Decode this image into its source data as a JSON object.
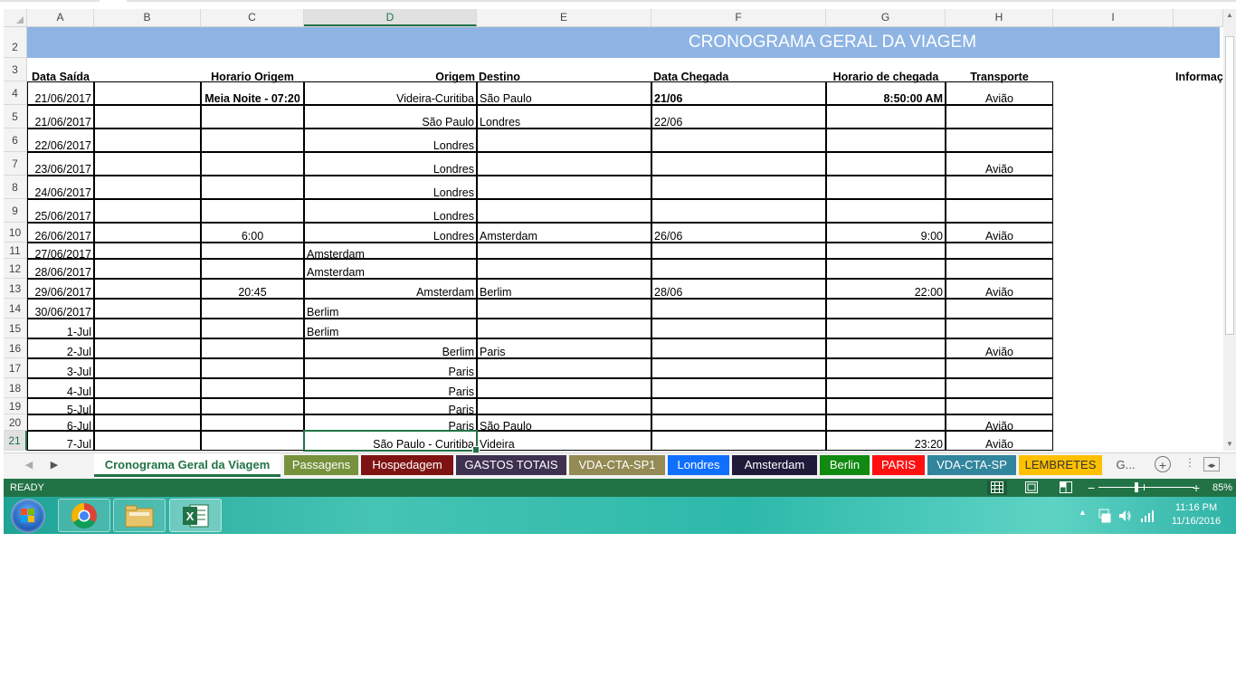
{
  "columns": [
    {
      "letter": "A",
      "width": 74
    },
    {
      "letter": "B",
      "width": 118
    },
    {
      "letter": "C",
      "width": 114
    },
    {
      "letter": "D",
      "width": 191
    },
    {
      "letter": "E",
      "width": 193
    },
    {
      "letter": "F",
      "width": 193
    },
    {
      "letter": "G",
      "width": 132
    },
    {
      "letter": "H",
      "width": 119
    },
    {
      "letter": "I",
      "width": 133
    }
  ],
  "selected_column": "D",
  "selected_row": "21",
  "title": "CRONOGRAMA GERAL DA VIAGEM",
  "headers": {
    "A": "Data Saída",
    "C": "Horario Origem",
    "D": "Origem",
    "E": "Destino",
    "F": "Data Chegada",
    "G": "Horario de chegada",
    "H": "Transporte",
    "J": "Informaç"
  },
  "rows": [
    {
      "num": "4",
      "A": "21/06/2017",
      "C": "Meia Noite - 07:20",
      "D": "Videira-Curitiba",
      "Dalign": "r",
      "E": "São Paulo",
      "F": "21/06",
      "G": "8:50:00 AM",
      "H": "Avião"
    },
    {
      "num": "5",
      "A": "21/06/2017",
      "C": "",
      "D": "São Paulo",
      "Dalign": "r",
      "E": "Londres",
      "F": "22/06",
      "G": "",
      "H": ""
    },
    {
      "num": "6",
      "A": "22/06/2017",
      "C": "",
      "D": "Londres",
      "Dalign": "r",
      "E": "",
      "F": "",
      "G": "",
      "H": ""
    },
    {
      "num": "7",
      "A": "23/06/2017",
      "C": "",
      "D": "Londres",
      "Dalign": "r",
      "E": "",
      "F": "",
      "G": "",
      "H": "Avião"
    },
    {
      "num": "8",
      "A": "24/06/2017",
      "C": "",
      "D": "Londres",
      "Dalign": "r",
      "E": "",
      "F": "",
      "G": "",
      "H": ""
    },
    {
      "num": "9",
      "A": "25/06/2017",
      "C": "",
      "D": "Londres",
      "Dalign": "r",
      "E": "",
      "F": "",
      "G": "",
      "H": ""
    },
    {
      "num": "10",
      "A": "26/06/2017",
      "C": "6:00",
      "D": "Londres",
      "Dalign": "r",
      "E": "Amsterdam",
      "F": "26/06",
      "G": "9:00",
      "H": "Avião"
    },
    {
      "num": "11",
      "A": "27/06/2017",
      "C": "",
      "D": "Amsterdam",
      "Dalign": "l",
      "E": "",
      "F": "",
      "G": "",
      "H": ""
    },
    {
      "num": "12",
      "A": "28/06/2017",
      "C": "",
      "D": "Amsterdam",
      "Dalign": "l",
      "E": "",
      "F": "",
      "G": "",
      "H": ""
    },
    {
      "num": "13",
      "A": "29/06/2017",
      "C": "20:45",
      "D": "Amsterdam",
      "Dalign": "r",
      "E": "Berlim",
      "F": "28/06",
      "G": "22:00",
      "H": "Avião"
    },
    {
      "num": "14",
      "A": "30/06/2017",
      "C": "",
      "D": "Berlim",
      "Dalign": "l",
      "E": "",
      "F": "",
      "G": "",
      "H": ""
    },
    {
      "num": "15",
      "A": "1-Jul",
      "C": "",
      "D": "Berlim",
      "Dalign": "l",
      "E": "",
      "F": "",
      "G": "",
      "H": ""
    },
    {
      "num": "16",
      "A": "2-Jul",
      "C": "",
      "D": "Berlim",
      "Dalign": "r",
      "E": "Paris",
      "F": "",
      "G": "",
      "H": "Avião"
    },
    {
      "num": "17",
      "A": "3-Jul",
      "C": "",
      "D": "Paris",
      "Dalign": "r",
      "E": "",
      "F": "",
      "G": "",
      "H": ""
    },
    {
      "num": "18",
      "A": "4-Jul",
      "C": "",
      "D": "Paris",
      "Dalign": "r",
      "E": "",
      "F": "",
      "G": "",
      "H": ""
    },
    {
      "num": "19",
      "A": "5-Jul",
      "C": "",
      "D": "Paris",
      "Dalign": "r",
      "E": "",
      "F": "",
      "G": "",
      "H": ""
    },
    {
      "num": "20",
      "A": "6-Jul",
      "C": "",
      "D": "Paris",
      "Dalign": "r",
      "E": "São Paulo",
      "F": "",
      "G": "",
      "H": "Avião"
    },
    {
      "num": "21",
      "A": "7-Jul",
      "C": "",
      "D": "São Paulo - Curitiba",
      "Dalign": "r",
      "E": "Videira",
      "F": "",
      "G": "23:20",
      "H": "Avião"
    }
  ],
  "tabs": [
    {
      "label": "Cronograma Geral da Viagem",
      "color": "#ffffff",
      "active": true
    },
    {
      "label": "Passagens",
      "color": "#76923c"
    },
    {
      "label": "Hospedagem",
      "color": "#7f1313"
    },
    {
      "label": "GASTOS TOTAIS",
      "color": "#3f3151"
    },
    {
      "label": "VDA-CTA-SP1",
      "color": "#948a54"
    },
    {
      "label": "Londres",
      "color": "#0f6fff"
    },
    {
      "label": "Amsterdam",
      "color": "#1f1a3a"
    },
    {
      "label": "Berlin",
      "color": "#108a10"
    },
    {
      "label": "PARIS",
      "color": "#ff1010"
    },
    {
      "label": "VDA-CTA-SP",
      "color": "#31859c"
    },
    {
      "label": "LEMBRETES",
      "color": "#ffc000"
    }
  ],
  "tab_overflow": "G...",
  "status": "READY",
  "zoom": {
    "label": "85%",
    "percent": 85
  },
  "taskbar": {
    "time": "11:16 PM",
    "date": "11/16/2016"
  },
  "icons": [
    "start-orb-icon",
    "chrome-icon",
    "file-explorer-icon",
    "excel-icon",
    "tray-up-arrow-icon",
    "network-icon",
    "volume-icon",
    "signal-icon",
    "normal-view-icon",
    "page-layout-icon",
    "page-break-icon",
    "new-sheet-icon"
  ]
}
